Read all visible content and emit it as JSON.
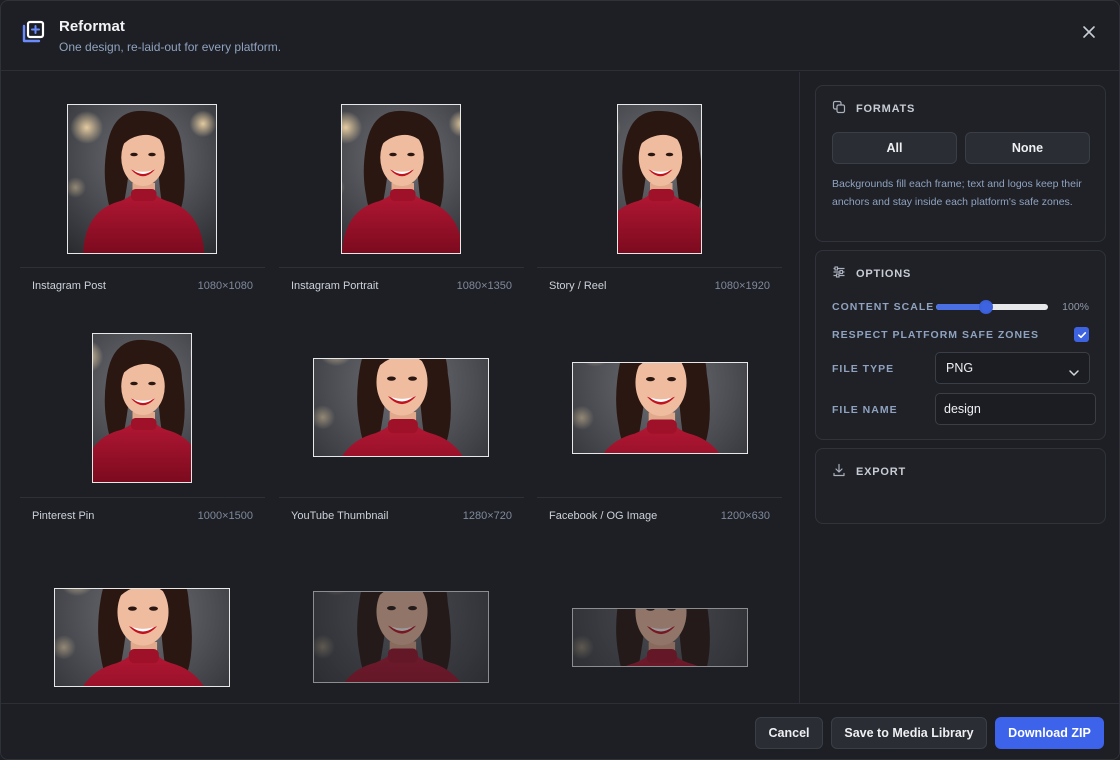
{
  "header": {
    "title": "Reformat",
    "subtitle": "One design, re-laid-out for every platform."
  },
  "formats": [
    {
      "name": "Instagram Post",
      "dims": "1080×1080"
    },
    {
      "name": "Instagram Portrait",
      "dims": "1080×1350"
    },
    {
      "name": "Story / Reel",
      "dims": "1080×1920"
    },
    {
      "name": "Pinterest Pin",
      "dims": "1000×1500"
    },
    {
      "name": "YouTube Thumbnail",
      "dims": "1280×720"
    },
    {
      "name": "Facebook / OG Image",
      "dims": "1200×630"
    },
    {
      "name": "",
      "dims": ""
    },
    {
      "name": "",
      "dims": ""
    },
    {
      "name": "",
      "dims": ""
    }
  ],
  "panel": {
    "formats": {
      "heading": "FORMATS",
      "all_label": "All",
      "none_label": "None",
      "note": "Backgrounds fill each frame; text and logos keep their anchors and stay inside each platform's safe zones."
    },
    "options": {
      "heading": "OPTIONS",
      "content_scale_label": "CONTENT SCALE",
      "content_scale_value": "100%",
      "content_scale_fraction": 0.45,
      "safe_zones_label": "RESPECT PLATFORM SAFE ZONES",
      "safe_zones_checked": true,
      "file_type_label": "FILE TYPE",
      "file_type_value": "PNG",
      "file_name_label": "FILE NAME",
      "file_name_value": "design"
    },
    "export": {
      "heading": "EXPORT"
    }
  },
  "footer": {
    "cancel_label": "Cancel",
    "save_label": "Save to Media Library",
    "download_label": "Download ZIP"
  },
  "colors": {
    "accent": "#3d63ea",
    "background": "#1d1f24",
    "muted_text": "#8fa3c0"
  }
}
